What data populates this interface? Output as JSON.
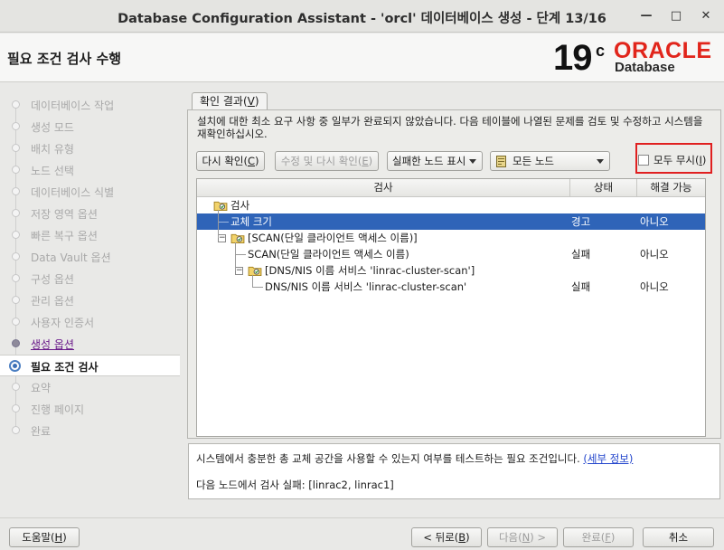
{
  "window": {
    "title": "Database Configuration Assistant - 'orcl' 데이터베이스 생성 - 단계 13/16",
    "minimize_label": "—",
    "maximize_label": "□",
    "close_label": "✕"
  },
  "header": {
    "page_title": "필요 조건 검사 수행",
    "logo_version": "19",
    "logo_version_suffix": "c",
    "logo_brand": "ORACLE",
    "logo_product": "Database"
  },
  "nav": {
    "items": [
      {
        "label": "데이터베이스 작업",
        "state": "disabled"
      },
      {
        "label": "생성 모드",
        "state": "disabled"
      },
      {
        "label": "배치 유형",
        "state": "disabled"
      },
      {
        "label": "노드 선택",
        "state": "disabled"
      },
      {
        "label": "데이터베이스 식별",
        "state": "disabled"
      },
      {
        "label": "저장 영역 옵션",
        "state": "disabled"
      },
      {
        "label": "빠른 복구 옵션",
        "state": "disabled"
      },
      {
        "label": "Data Vault 옵션",
        "state": "disabled"
      },
      {
        "label": "구성 옵션",
        "state": "disabled"
      },
      {
        "label": "관리 옵션",
        "state": "disabled"
      },
      {
        "label": "사용자 인증서",
        "state": "disabled"
      },
      {
        "label": "생성 옵션",
        "state": "visited"
      },
      {
        "label": "필요 조건 검사",
        "state": "current"
      },
      {
        "label": "요약",
        "state": "disabled"
      },
      {
        "label": "진행 페이지",
        "state": "disabled"
      },
      {
        "label": "완료",
        "state": "disabled"
      }
    ]
  },
  "content": {
    "tab_label": "확인 결과(",
    "tab_mnemonic": "V",
    "tab_suffix": ")",
    "description": "설치에 대한 최소 요구 사항 중 일부가 완료되지 않았습니다. 다음 테이블에 나열된 문제를 검토 및 수정하고 시스템을 재확인하십시오.",
    "recheck_label": "다시 확인(",
    "recheck_mnemonic": "C",
    "recheck_suffix": ")",
    "fix_label": "수정 및 다시 확인(",
    "fix_mnemonic": "E",
    "fix_suffix": ")",
    "filter_value": "실패한 노드 표시",
    "node_value": "모든 노드",
    "ignore_all_label": "모두 무시(",
    "ignore_all_mnemonic": "I",
    "ignore_all_suffix": ")",
    "ignore_all_checked": false
  },
  "table": {
    "columns": [
      "검사",
      "상태",
      "해결 가능"
    ],
    "rows": [
      {
        "check": "검사",
        "status": "",
        "fixable": "",
        "level": 0,
        "kind": "root"
      },
      {
        "check": "교체 크기",
        "status": "경고",
        "fixable": "아니오",
        "level": 1,
        "kind": "leaf",
        "selected": true
      },
      {
        "check": "[SCAN(단일 클라이언트 액세스 이름)]",
        "status": "",
        "fixable": "",
        "level": 1,
        "kind": "group"
      },
      {
        "check": "SCAN(단일 클라이언트 액세스 이름)",
        "status": "실패",
        "fixable": "아니오",
        "level": 2,
        "kind": "leaf"
      },
      {
        "check": "[DNS/NIS 이름 서비스 'linrac-cluster-scan']",
        "status": "",
        "fixable": "",
        "level": 2,
        "kind": "group"
      },
      {
        "check": "DNS/NIS 이름 서비스 'linrac-cluster-scan'",
        "status": "실패",
        "fixable": "아니오",
        "level": 3,
        "kind": "leaf"
      }
    ]
  },
  "detail": {
    "text": "시스템에서 충분한 총 교체 공간을 사용할 수 있는지 여부를 테스트하는 필요 조건입니다.",
    "link": "(세부 정보)",
    "failed_nodes": "다음 노드에서 검사 실패: [linrac2, linrac1]"
  },
  "footer": {
    "help_label": "도움말(",
    "help_mnemonic": "H",
    "help_suffix": ")",
    "back_label": "< 뒤로(",
    "back_mnemonic": "B",
    "back_suffix": ")",
    "next_label": "다음(",
    "next_mnemonic": "N",
    "next_suffix": ") >",
    "finish_label": "완료(",
    "finish_mnemonic": "F",
    "finish_suffix": ")",
    "cancel_label": "취소"
  }
}
